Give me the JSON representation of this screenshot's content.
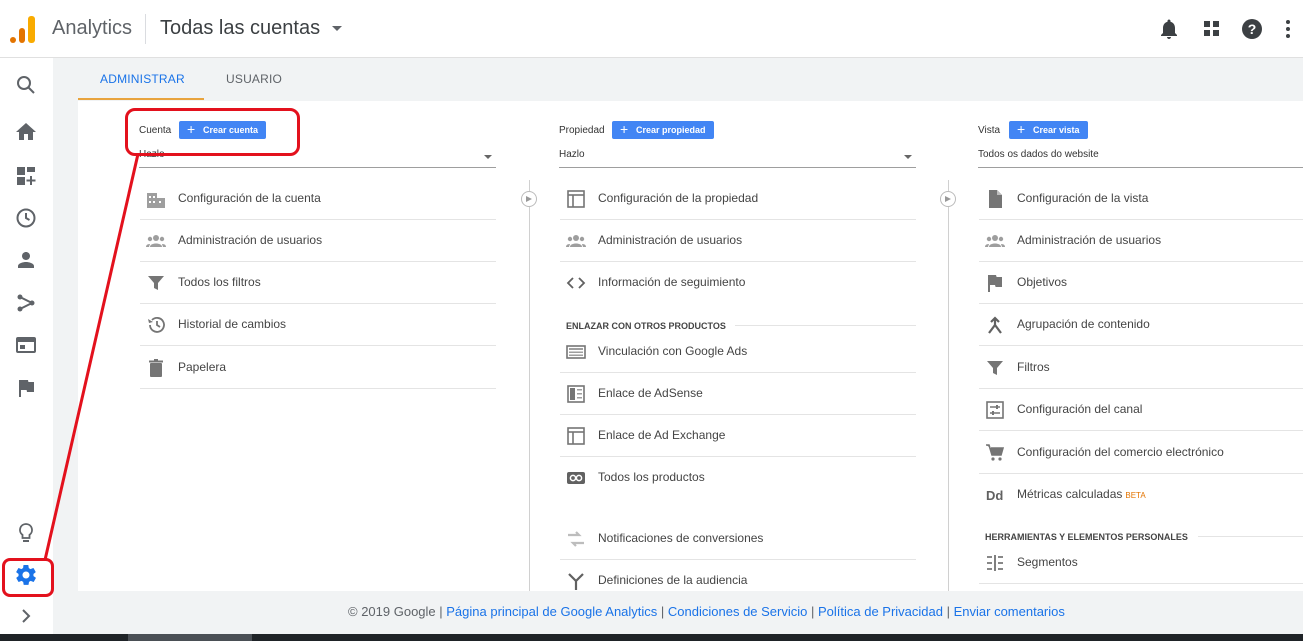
{
  "header": {
    "app_name": "Analytics",
    "account_picker": "Todas las cuentas"
  },
  "tabs": [
    {
      "label": "ADMINISTRAR",
      "active": true
    },
    {
      "label": "USUARIO",
      "active": false
    }
  ],
  "columns": {
    "account": {
      "label": "Cuenta",
      "create_button": "Crear cuenta",
      "selector_value": "Hazlo",
      "items": [
        {
          "label": "Configuración de la cuenta",
          "icon": "building-icon"
        },
        {
          "label": "Administración de usuarios",
          "icon": "people-icon"
        },
        {
          "label": "Todos los filtros",
          "icon": "filter-icon"
        },
        {
          "label": "Historial de cambios",
          "icon": "history-icon"
        },
        {
          "label": "Papelera",
          "icon": "trash-icon"
        }
      ]
    },
    "property": {
      "label": "Propiedad",
      "create_button": "Crear propiedad",
      "selector_value": "Hazlo",
      "items": [
        {
          "label": "Configuración de la propiedad",
          "icon": "window-icon"
        },
        {
          "label": "Administración de usuarios",
          "icon": "people-icon"
        },
        {
          "label": "Información de seguimiento",
          "icon": "code-icon"
        }
      ],
      "section_header": "ENLAZAR CON OTROS PRODUCTOS",
      "linked_items": [
        {
          "label": "Vinculación con Google Ads",
          "icon": "ads-icon"
        },
        {
          "label": "Enlace de AdSense",
          "icon": "adsense-icon"
        },
        {
          "label": "Enlace de Ad Exchange",
          "icon": "adexchange-icon"
        },
        {
          "label": "Todos los productos",
          "icon": "link-icon"
        }
      ],
      "more_items": [
        {
          "label": "Notificaciones de conversiones",
          "icon": "conversion-icon"
        },
        {
          "label": "Definiciones de la audiencia",
          "icon": "audience-icon"
        }
      ]
    },
    "view": {
      "label": "Vista",
      "create_button": "Crear vista",
      "selector_value": "Todos os dados do website",
      "items": [
        {
          "label": "Configuración de la vista",
          "icon": "document-icon"
        },
        {
          "label": "Administración de usuarios",
          "icon": "people-icon"
        },
        {
          "label": "Objetivos",
          "icon": "flag-icon"
        },
        {
          "label": "Agrupación de contenido",
          "icon": "grouping-icon"
        },
        {
          "label": "Filtros",
          "icon": "filter-icon"
        },
        {
          "label": "Configuración del canal",
          "icon": "channel-icon"
        },
        {
          "label": "Configuración del comercio electrónico",
          "icon": "cart-icon"
        },
        {
          "label": "Métricas calculadas",
          "badge": "BETA",
          "icon": "dd-icon"
        }
      ],
      "section_header": "HERRAMIENTAS Y ELEMENTOS PERSONALES",
      "tool_items": [
        {
          "label": "Segmentos",
          "icon": "segments-icon"
        }
      ]
    }
  },
  "footer": {
    "copyright": "© 2019 Google",
    "links": [
      "Página principal de Google Analytics",
      "Condiciones de Servicio",
      "Política de Privacidad",
      "Enviar comentarios"
    ]
  },
  "colors": {
    "accent": "#1a73e8",
    "button": "#4285f4",
    "annotation": "#e3111d",
    "logo_orange": "#e37400",
    "logo_yellow": "#f9ab00"
  }
}
